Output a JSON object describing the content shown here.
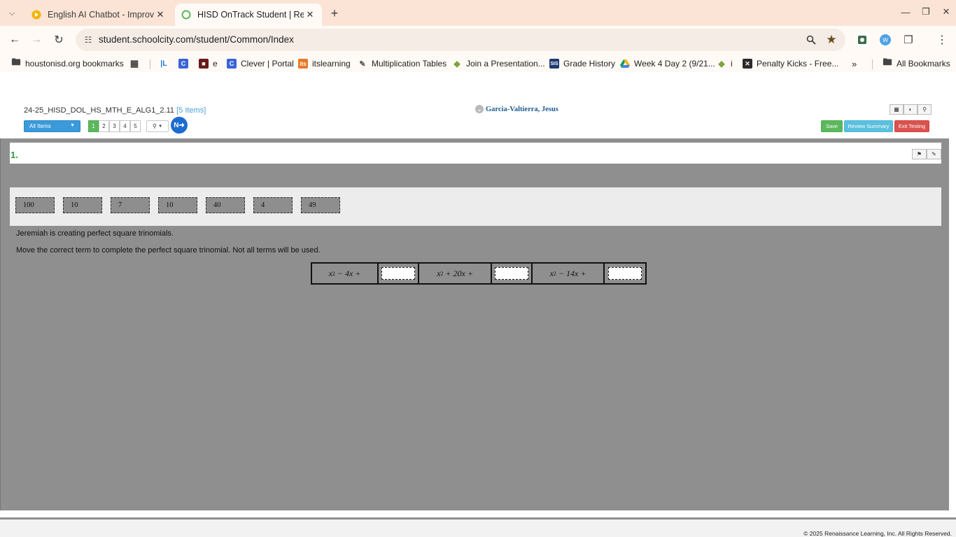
{
  "browser": {
    "tabs": [
      {
        "title": "English AI Chatbot - Improve Yo",
        "active": false,
        "favicon": "chatbot-icon",
        "favicon_color": "#f4b400"
      },
      {
        "title": "HISD OnTrack Student | Renaiss",
        "active": true,
        "favicon": "loading-ring-icon",
        "favicon_color": "#5cb85c"
      }
    ],
    "url": "student.schoolcity.com/student/Common/Index",
    "bookmarks": [
      {
        "label": "houstonisd.org bookmarks",
        "icon": "managed-folder-icon"
      },
      {
        "label": "",
        "icon": "apps-grid-icon"
      },
      {
        "label": "",
        "icon": "ixl-icon"
      },
      {
        "label": "",
        "icon": "clever-c-icon"
      },
      {
        "label": "e",
        "icon": "site-icon"
      },
      {
        "label": "Clever | Portal",
        "icon": "clever-c-icon"
      },
      {
        "label": "itslearning",
        "icon": "itslearning-icon"
      },
      {
        "label": "Multiplication Tables",
        "icon": "math-icon"
      },
      {
        "label": "Join a Presentation...",
        "icon": "pear-icon"
      },
      {
        "label": "Grade History",
        "icon": "sis-icon"
      },
      {
        "label": "Week 4 Day 2 (9/21...",
        "icon": "drive-icon"
      },
      {
        "label": "i",
        "icon": "pear-icon"
      },
      {
        "label": "Penalty Kicks - Free...",
        "icon": "x-site-icon"
      }
    ],
    "all_bookmarks": "All Bookmarks"
  },
  "header": {
    "test_name": "24-25_HISD_DOL_HS_MTH_E_ALG1_2.11",
    "item_count": "[5 Items]",
    "student_name": "Garcia-Valtierra, Jesus",
    "all_items_label": "All Items",
    "pages": [
      "1",
      "2",
      "3",
      "4",
      "5"
    ],
    "current_page": "1",
    "next_label": "N",
    "save_label": "Save",
    "review_label": "Review Summary",
    "exit_label": "Exit Testing"
  },
  "question": {
    "number": "1.",
    "terms": [
      "100",
      "10",
      "7",
      "10",
      "40",
      "4",
      "49"
    ],
    "prompt_1": "Jeremiah is creating perfect square trinomials.",
    "prompt_2": "Move the correct term to complete the perfect square trinomial. Not all terms will be used.",
    "expressions": [
      {
        "base": "x",
        "exp": "2",
        "rest": " − 4x +"
      },
      {
        "base": "x",
        "exp": "2",
        "rest": " + 20x +"
      },
      {
        "base": "x",
        "exp": "2",
        "rest": " − 14x +"
      }
    ]
  },
  "footer": {
    "copyright": "© 2025 Renaissance Learning, Inc. All Rights Reserved."
  }
}
